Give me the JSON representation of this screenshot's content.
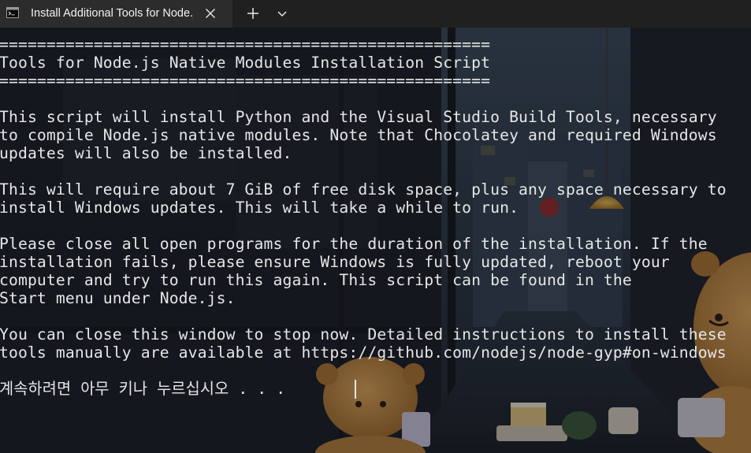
{
  "tab": {
    "title": "Install Additional Tools for Node.js",
    "icon": "terminal-icon",
    "close_icon": "close-icon",
    "new_tab_icon": "plus-icon",
    "dropdown_icon": "chevron-down-icon"
  },
  "terminal": {
    "lines": [
      "====================================================",
      "Tools for Node.js Native Modules Installation Script",
      "====================================================",
      "",
      "This script will install Python and the Visual Studio Build Tools, necessary",
      "to compile Node.js native modules. Note that Chocolatey and required Windows",
      "updates will also be installed.",
      "",
      "This will require about 7 GiB of free disk space, plus any space necessary to",
      "install Windows updates. This will take a while to run.",
      "",
      "Please close all open programs for the duration of the installation. If the",
      "installation fails, please ensure Windows is fully updated, reboot your",
      "computer and try to run this again. This script can be found in the",
      "Start menu under Node.js.",
      "",
      "You can close this window to stop now. Detailed instructions to install these",
      "tools manually are available at https://github.com/nodejs/node-gyp#on-windows",
      "",
      "계속하려면 아무 키나 누르십시오 . . ."
    ]
  },
  "colors": {
    "tabbar": "#202020",
    "active_tab": "#2c2c2c",
    "text": "#e6e6e6"
  }
}
